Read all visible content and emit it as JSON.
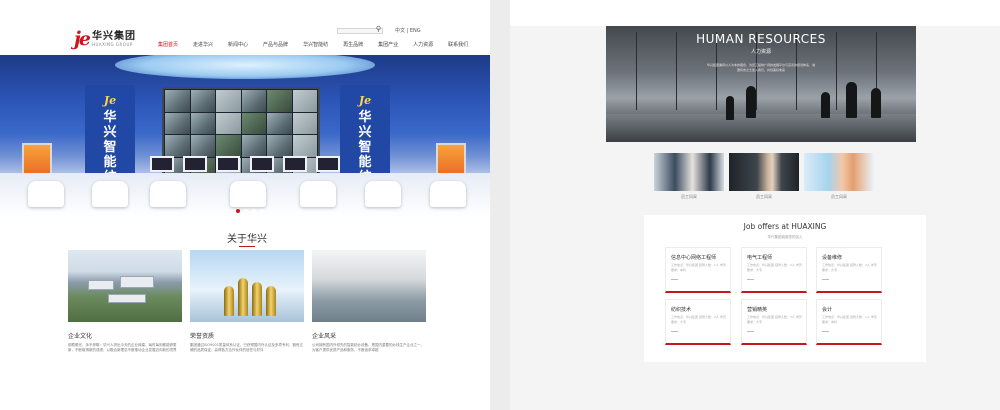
{
  "left": {
    "logo": {
      "mark": "je",
      "name": "华兴集团",
      "sub": "HUAXING GROUP"
    },
    "lang_label": "中文 | ENG",
    "nav": [
      "集团首页",
      "走进华兴",
      "新闻中心",
      "产品与品牌",
      "华兴智能纺",
      "再生品牌",
      "集团产业",
      "人力资源",
      "联系我们"
    ],
    "hero_brand_mark": "Je",
    "hero_brand": "华兴智能纺",
    "about": {
      "title": "关于华兴",
      "cards": [
        {
          "title": "企业文化",
          "text": "前瞻眼光，永不停歇：华兴人拼出今天的企业辉煌，每时每刻都能够更新，不断取得新的成绩，以融合新理念不断推动企业发展迈向新的境界"
        },
        {
          "title": "荣誉资质",
          "text": "集团通过ISO9001质量体系认证，已获得国内外认证及多项专利，拥有过硬的品质保证，赢得各方合作伙伴的信任与好评"
        },
        {
          "title": "企业风采",
          "text": "公司拥有国内外领先的智能纺纱设备，是国内重要的纱线生产企业之一，为客户提供优质产品和服务，不断追求卓越"
        }
      ]
    }
  },
  "right": {
    "hero": {
      "title": "HUMAN RESOURCES",
      "subtitle": "人力资源",
      "body": "华兴集团秉持以人为本的理念，为员工提供广阔的发展平台与完善的培训体系，诚邀有志之士加入我们，共创美好未来"
    },
    "thumbs": [
      "员工风采",
      "员工风采",
      "员工风采"
    ],
    "jobs": {
      "title": "Job offers at HUAXING",
      "subtitle": "华兴集团诚邀您的加入",
      "items": [
        {
          "title": "信息中心网络工程师",
          "meta": "工作地点：华兴集团  招聘人数：1人  学历要求：本科"
        },
        {
          "title": "电气工程师",
          "meta": "工作地点：华兴集团  招聘人数：2人  学历要求：大专"
        },
        {
          "title": "设备维修",
          "meta": "工作地点：华兴集团  招聘人数：3人  学历要求：大专"
        },
        {
          "title": "纺织技术",
          "meta": "工作地点：华兴集团  招聘人数：2人  学历要求：大专"
        },
        {
          "title": "营销精英",
          "meta": "工作地点：华兴集团  招聘人数：5人  学历要求：大专"
        },
        {
          "title": "会计",
          "meta": "工作地点：华兴集团  招聘人数：1人  学历要求：本科"
        }
      ]
    }
  }
}
